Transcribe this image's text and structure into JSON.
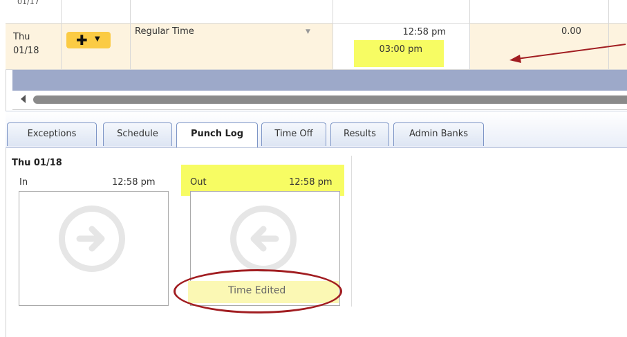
{
  "timecard": {
    "prev_row_date": "01/17",
    "row": {
      "day": "Thu",
      "date": "01/18",
      "paycode": "Regular Time",
      "in_time": "12:58 pm",
      "out_time": "03:00 pm",
      "total": "0.00"
    }
  },
  "tabs": [
    {
      "label": "Exceptions"
    },
    {
      "label": "Schedule"
    },
    {
      "label": "Punch Log",
      "active": true
    },
    {
      "label": "Time Off"
    },
    {
      "label": "Results"
    },
    {
      "label": "Admin Banks"
    }
  ],
  "punch_log": {
    "date": "Thu 01/18",
    "in_label": "In",
    "in_time": "12:58 pm",
    "out_label": "Out",
    "out_time": "12:58 pm",
    "out_status": "Time Edited"
  },
  "colors": {
    "highlight_yellow": "#f7fc63",
    "annotation_red": "#a11d21",
    "row_bg": "#fdf3df",
    "add_button": "#fbcb44"
  },
  "icons": {
    "add": "plus-icon",
    "dropdown": "caret-down-icon",
    "in_punch": "arrow-right-circle-icon",
    "out_punch": "arrow-left-circle-icon"
  }
}
